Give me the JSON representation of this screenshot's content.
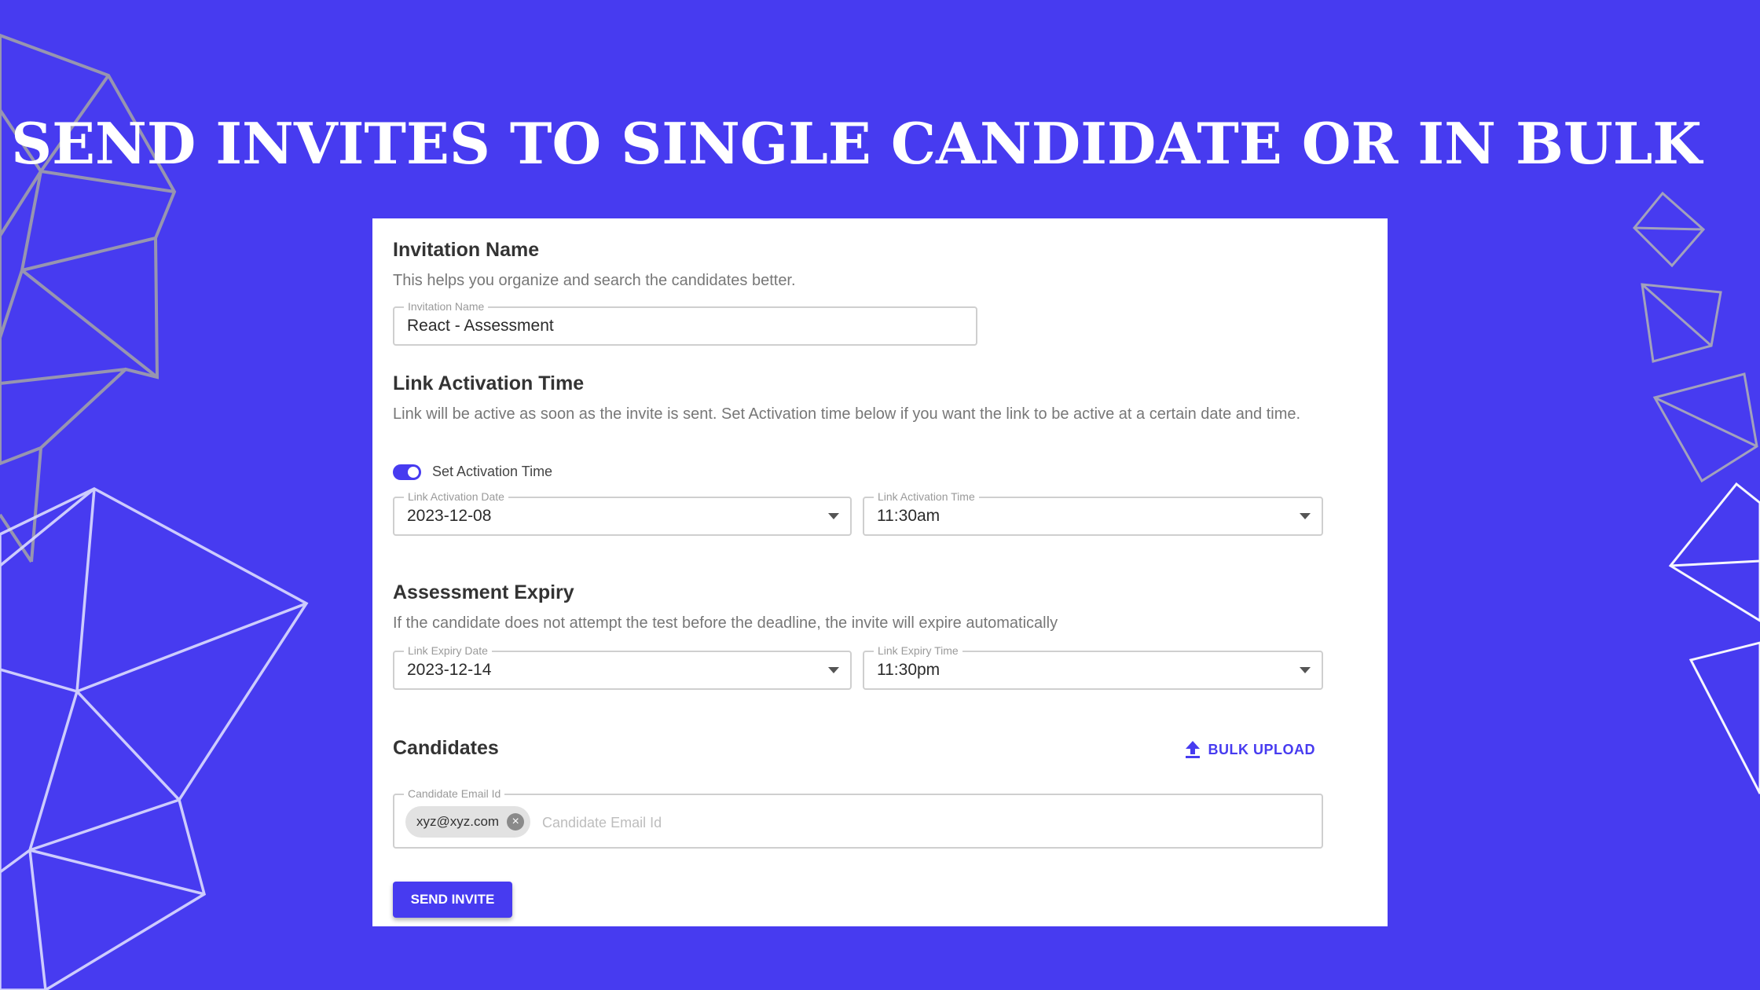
{
  "headline": "SEND INVITES TO SINGLE CANDIDATE OR IN BULK",
  "colors": {
    "background": "#473bf0",
    "accent": "#473bf0",
    "card": "#ffffff"
  },
  "invitation": {
    "title": "Invitation Name",
    "description": "This helps you organize and search the candidates better.",
    "field_label": "Invitation Name",
    "value": "React - Assessment"
  },
  "activation": {
    "title": "Link Activation Time",
    "description": "Link will be active as soon as the invite is sent. Set Activation time below if you want the link to be active at a certain date and time.",
    "toggle_label": "Set Activation Time",
    "toggle_on": true,
    "date_label": "Link Activation Date",
    "date_value": "2023-12-08",
    "time_label": "Link Activation Time",
    "time_value": "11:30am"
  },
  "expiry": {
    "title": "Assessment Expiry",
    "description": "If the candidate does not attempt the test before the deadline, the invite will expire automatically",
    "date_label": "Link Expiry Date",
    "date_value": "2023-12-14",
    "time_label": "Link Expiry Time",
    "time_value": "11:30pm"
  },
  "candidates": {
    "title": "Candidates",
    "bulk_upload_label": "BULK UPLOAD",
    "field_label": "Candidate Email Id",
    "placeholder": "Candidate Email Id",
    "chips": [
      "xyz@xyz.com"
    ]
  },
  "send_button_label": "SEND INVITE",
  "icons": {
    "upload": "upload-icon",
    "chip_remove": "close-circle-icon",
    "dropdown": "caret-down-icon"
  }
}
